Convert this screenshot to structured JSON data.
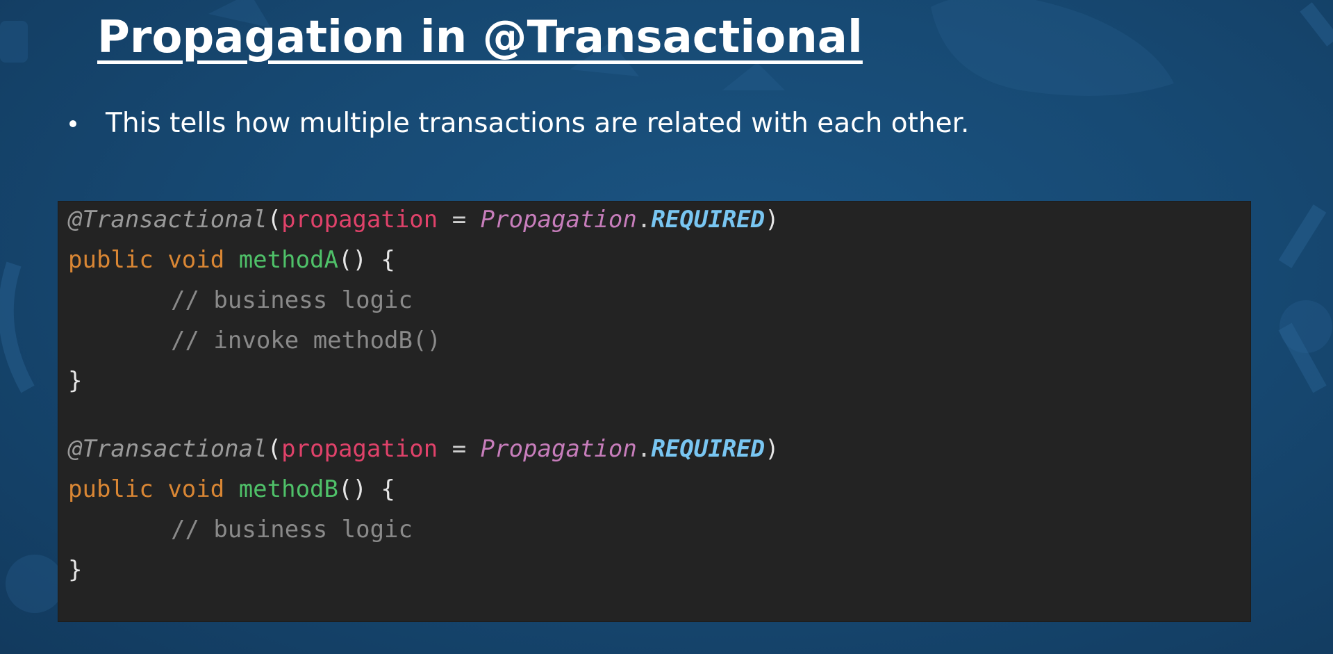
{
  "slide": {
    "title": "Propagation in @Transactional",
    "bullet": "This tells how multiple transactions are related with each other."
  },
  "code": {
    "annotation": "@Transactional",
    "open_paren": "(",
    "param": "propagation",
    "equals": " = ",
    "enum_class": "Propagation",
    "dot": ".",
    "enum_value": "REQUIRED",
    "close_paren": ")",
    "kw_public": "public",
    "kw_void": "void",
    "method_a": "methodA",
    "method_b": "methodB",
    "parens_brace": "() {",
    "comment_business": "// business logic",
    "comment_invoke": "// invoke methodB()",
    "close_brace": "}"
  },
  "colors": {
    "background": "#174a74",
    "code_background": "#232323",
    "annotation": "#9a9a9a",
    "parameter": "#e0426a",
    "enum_class": "#c77dbb",
    "enum_value": "#79c6f2",
    "keyword": "#d98634",
    "method_name": "#4fc169",
    "comment": "#8a8a8a"
  }
}
